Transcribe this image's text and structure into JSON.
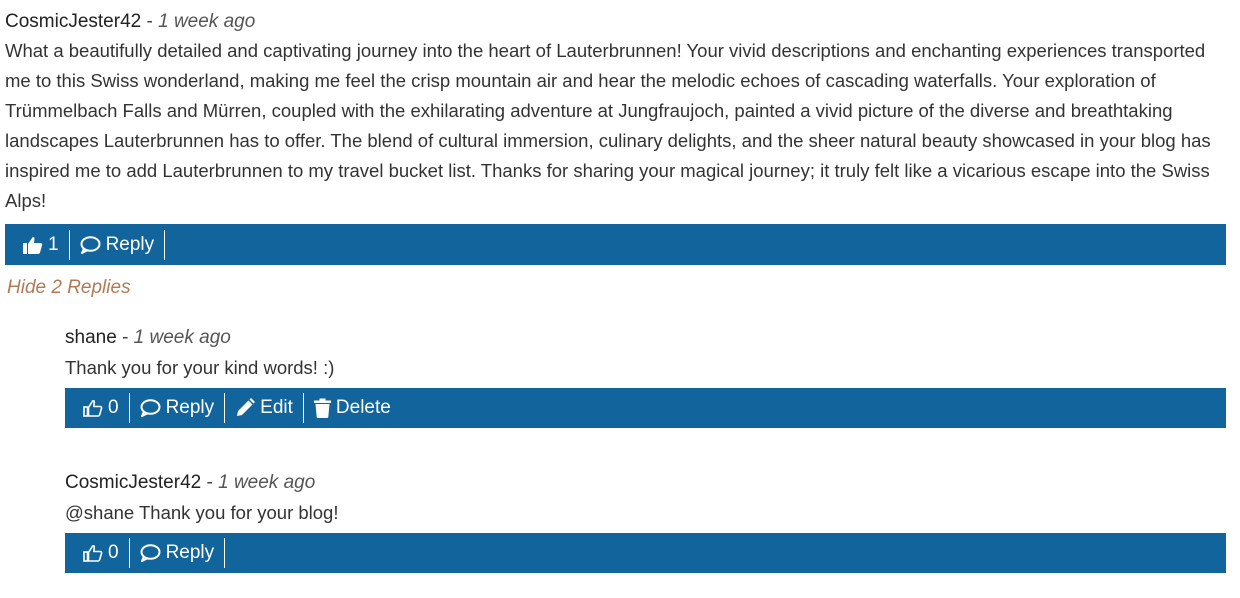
{
  "comment": {
    "author": "CosmicJester42",
    "separator": "-",
    "time": "1 week ago",
    "text": "What a beautifully detailed and captivating journey into the heart of Lauterbrunnen! Your vivid descriptions and enchanting experiences transported me to this Swiss wonderland, making me feel the crisp mountain air and hear the melodic echoes of cascading waterfalls. Your exploration of Trümmelbach Falls and Mürren, coupled with the exhilarating adventure at Jungfraujoch, painted a vivid picture of the diverse and breathtaking landscapes Lauterbrunnen has to offer. The blend of cultural immersion, culinary delights, and the sheer natural beauty showcased in your blog has inspired me to add Lauterbrunnen to my travel bucket list. Thanks for sharing your magical journey; it truly felt like a vicarious escape into the Swiss Alps!",
    "likes": "1",
    "reply_label": "Reply"
  },
  "toggle_label": "Hide 2 Replies",
  "replies": [
    {
      "author": "shane",
      "separator": "-",
      "time": "1 week ago",
      "text": "Thank you for your kind words! :)",
      "likes": "0",
      "reply_label": "Reply",
      "edit_label": "Edit",
      "delete_label": "Delete"
    },
    {
      "author": "CosmicJester42",
      "separator": "-",
      "time": "1 week ago",
      "text": "@shane Thank you for your blog!",
      "likes": "0",
      "reply_label": "Reply"
    }
  ],
  "colors": {
    "action_bar": "#12649c",
    "toggle_link": "#b07a55"
  },
  "icons": {
    "like_filled": "thumbs-up-icon",
    "like_outline": "thumbs-up-outline-icon",
    "reply": "comment-bubble-icon",
    "edit": "pencil-icon",
    "delete": "trash-icon"
  }
}
